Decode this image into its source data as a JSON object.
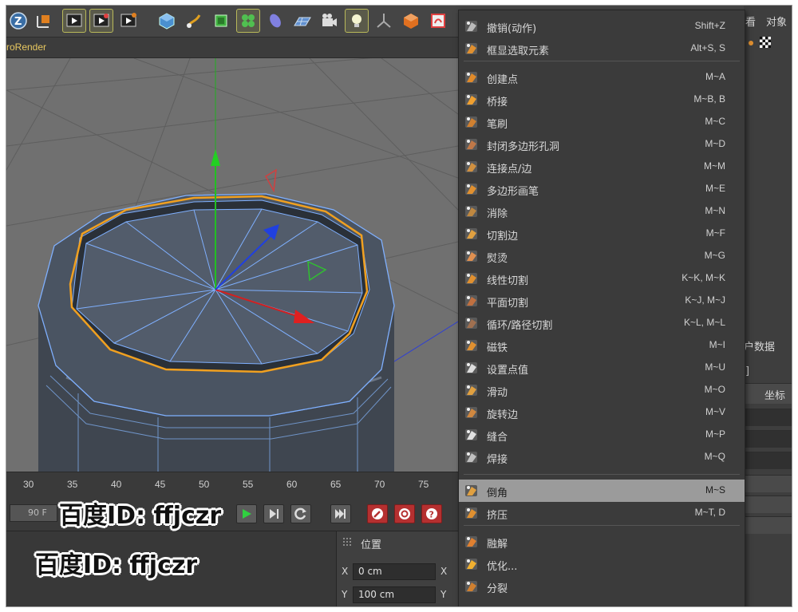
{
  "subbar": {
    "label": "roRender"
  },
  "toolbar": {
    "buttons": [
      "z-logo-icon",
      "coordinate-system-icon",
      "render-view-icon",
      "render-picture-viewer-icon",
      "render-settings-icon",
      "cube-icon",
      "pen-icon",
      "subdivision-icon",
      "cloner-icon",
      "deformer-icon",
      "floor-icon",
      "camera-icon",
      "light-icon",
      "joint-icon",
      "sculpt-icon",
      "script-icon"
    ]
  },
  "timeline": {
    "ticks": [
      "30",
      "35",
      "40",
      "45",
      "50",
      "55",
      "60",
      "65",
      "70",
      "75"
    ],
    "frame_field": "90 F"
  },
  "coordinates": {
    "title": "位置",
    "rows": [
      {
        "axis": "X",
        "value": "0 cm",
        "axis2": "X"
      },
      {
        "axis": "Y",
        "value": "100 cm",
        "axis2": "Y"
      }
    ]
  },
  "right_panel": {
    "tab_partial": "看",
    "tab_objects": "对象",
    "user_data_partial": "户数据",
    "bracket": "]",
    "coordinates_tab": "坐标"
  },
  "menu": {
    "items": [
      {
        "label": "撤销(动作)",
        "shortcut": "Shift+Z",
        "icon": "undo-action-icon"
      },
      {
        "label": "框显选取元素",
        "shortcut": "Alt+S, S",
        "icon": "frame-selected-icon"
      },
      {
        "label": "创建点",
        "shortcut": "M~A",
        "icon": "create-point-icon"
      },
      {
        "label": "桥接",
        "shortcut": "M~B, B",
        "icon": "bridge-icon"
      },
      {
        "label": "笔刷",
        "shortcut": "M~C",
        "icon": "brush-icon"
      },
      {
        "label": "封闭多边形孔洞",
        "shortcut": "M~D",
        "icon": "close-polygon-hole-icon"
      },
      {
        "label": "连接点/边",
        "shortcut": "M~M",
        "icon": "connect-points-edges-icon"
      },
      {
        "label": "多边形画笔",
        "shortcut": "M~E",
        "icon": "polygon-pen-icon"
      },
      {
        "label": "消除",
        "shortcut": "M~N",
        "icon": "dissolve-icon"
      },
      {
        "label": "切割边",
        "shortcut": "M~F",
        "icon": "edge-cut-icon"
      },
      {
        "label": "熨烫",
        "shortcut": "M~G",
        "icon": "iron-icon"
      },
      {
        "label": "线性切割",
        "shortcut": "K~K, M~K",
        "icon": "line-cut-icon"
      },
      {
        "label": "平面切割",
        "shortcut": "K~J, M~J",
        "icon": "plane-cut-icon"
      },
      {
        "label": "循环/路径切割",
        "shortcut": "K~L, M~L",
        "icon": "loop-path-cut-icon"
      },
      {
        "label": "磁铁",
        "shortcut": "M~I",
        "icon": "magnet-icon"
      },
      {
        "label": "设置点值",
        "shortcut": "M~U",
        "icon": "set-point-value-icon"
      },
      {
        "label": "滑动",
        "shortcut": "M~O",
        "icon": "slide-icon"
      },
      {
        "label": "旋转边",
        "shortcut": "M~V",
        "icon": "spin-edge-icon"
      },
      {
        "label": "缝合",
        "shortcut": "M~P",
        "icon": "stitch-icon"
      },
      {
        "label": "焊接",
        "shortcut": "M~Q",
        "icon": "weld-icon"
      },
      {
        "label": "倒角",
        "shortcut": "M~S",
        "icon": "bevel-icon"
      },
      {
        "label": "挤压",
        "shortcut": "M~T, D",
        "icon": "extrude-icon"
      },
      {
        "label": "融解",
        "shortcut": "",
        "icon": "melt-icon"
      },
      {
        "label": "优化...",
        "shortcut": "",
        "icon": "optimize-icon"
      },
      {
        "label": "分裂",
        "shortcut": "",
        "icon": "split-icon"
      }
    ]
  },
  "watermarks": [
    "百度ID: ffjczr",
    "百度ID: ffjczr"
  ],
  "colors": {
    "accent_selection": "#f0a020",
    "mesh_edge": "#7fb0ff",
    "axis_x": "#e02020",
    "axis_y": "#20c020",
    "axis_z": "#2040e0",
    "menu_highlight": "#9b9b9b"
  }
}
